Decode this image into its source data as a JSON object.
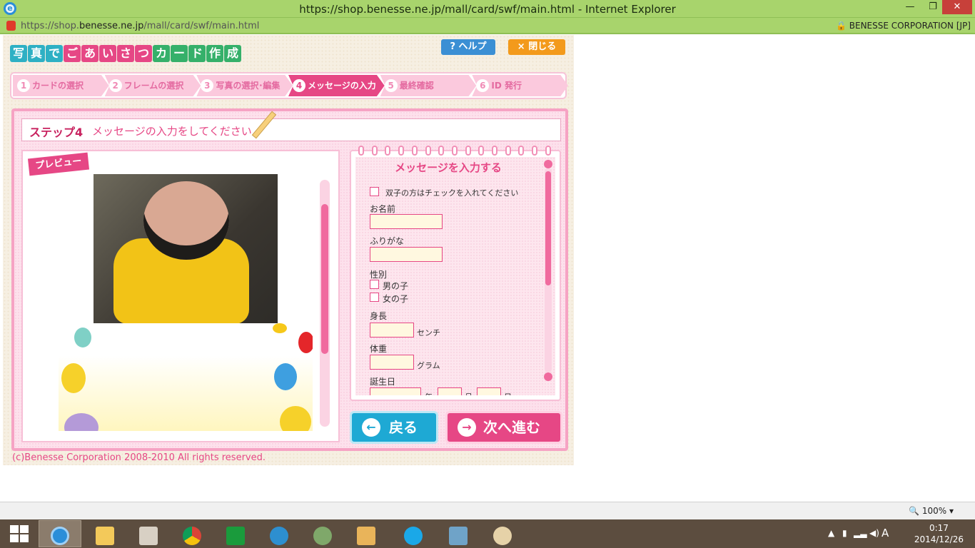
{
  "window": {
    "title": "https://shop.benesse.ne.jp/mall/card/swf/main.html - Internet Explorer",
    "min": "—",
    "restore": "❐",
    "close": "✕"
  },
  "address": {
    "url_prefix": "https://shop.",
    "url_domain": "benesse.ne.jp",
    "url_path": "/mall/card/swf/main.html",
    "org": "BENESSE CORPORATION [JP]"
  },
  "app": {
    "logo_chars": [
      "写",
      "真",
      "で",
      "ご",
      "あ",
      "い",
      "さ",
      "つ",
      "カ",
      "ー",
      "ド",
      "作",
      "成"
    ],
    "logo_colors": [
      "#2eb0c4",
      "#2eb0c4",
      "#2eb0c4",
      "#e64785",
      "#e64785",
      "#e64785",
      "#e64785",
      "#e64785",
      "#35b06a",
      "#35b06a",
      "#35b06a",
      "#35b06a",
      "#35b06a"
    ],
    "help_label": "? ヘルプ",
    "close_label": "× 閉じる",
    "steps": [
      {
        "num": "1",
        "label": "カードの選択"
      },
      {
        "num": "2",
        "label": "フレームの選択"
      },
      {
        "num": "3",
        "label": "写真の選択･編集"
      },
      {
        "num": "4",
        "label": "メッセージの入力"
      },
      {
        "num": "5",
        "label": "最終確認"
      },
      {
        "num": "6",
        "label": "ID 発行"
      }
    ],
    "step_title": "ステップ4",
    "step_desc": "メッセージの入力をしてください",
    "preview_label": "プレビュー",
    "form": {
      "title": "メッセージを入力する",
      "twins_label": "双子の方はチェックを入れてください",
      "name_label": "お名前",
      "kana_label": "ふりがな",
      "gender_label": "性別",
      "male_label": "男の子",
      "female_label": "女の子",
      "height_label": "身長",
      "height_unit": "センチ",
      "weight_label": "体重",
      "weight_unit": "グラム",
      "birthday_label": "誕生日",
      "year_unit": "年",
      "month_unit": "月",
      "day_unit": "日"
    },
    "back_label": "戻る",
    "next_label": "次へ進む",
    "copyright": "(c)Benesse Corporation 2008-2010 All rights reserved."
  },
  "status": {
    "zoom": "100%"
  },
  "taskbar": {
    "apps": [
      "internet-explorer",
      "file-explorer",
      "media-app",
      "chrome",
      "store",
      "browser-swirl",
      "game-app",
      "photo-folder",
      "skype",
      "photos",
      "paint"
    ],
    "ime": "A",
    "time": "0:17",
    "date": "2014/12/26"
  }
}
